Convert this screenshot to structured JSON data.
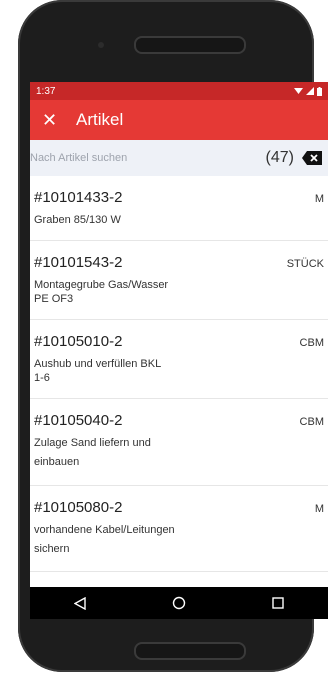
{
  "status": {
    "time": "1:37"
  },
  "appbar": {
    "title": "Artikel"
  },
  "search": {
    "placeholder": "Nach Artikel suchen",
    "count": "(47)"
  },
  "items": [
    {
      "code": "#10101433-2",
      "unit": "M",
      "description": "Graben 85/130 W"
    },
    {
      "code": "#10101543-2",
      "unit": "STÜCK",
      "description": "Montagegrube Gas/Wasser\nPE OF3"
    },
    {
      "code": "#10105010-2",
      "unit": "CBM",
      "description": "Aushub und verfüllen BKL\n1-6"
    },
    {
      "code": "#10105040-2",
      "unit": "CBM",
      "description": "Zulage Sand liefern und\neinbauen"
    },
    {
      "code": "#10105080-2",
      "unit": "M",
      "description": "vorhandene Kabel/Leitungen\nsichern"
    }
  ],
  "colors": {
    "statusbar": "#c62828",
    "appbar": "#e53935",
    "searchbar": "#eef1f7",
    "navbar": "#000000"
  },
  "icons": [
    "close-icon",
    "wifi-icon",
    "signal-icon",
    "battery-icon",
    "backspace-icon",
    "nav-back-icon",
    "nav-home-icon",
    "nav-recents-icon"
  ]
}
